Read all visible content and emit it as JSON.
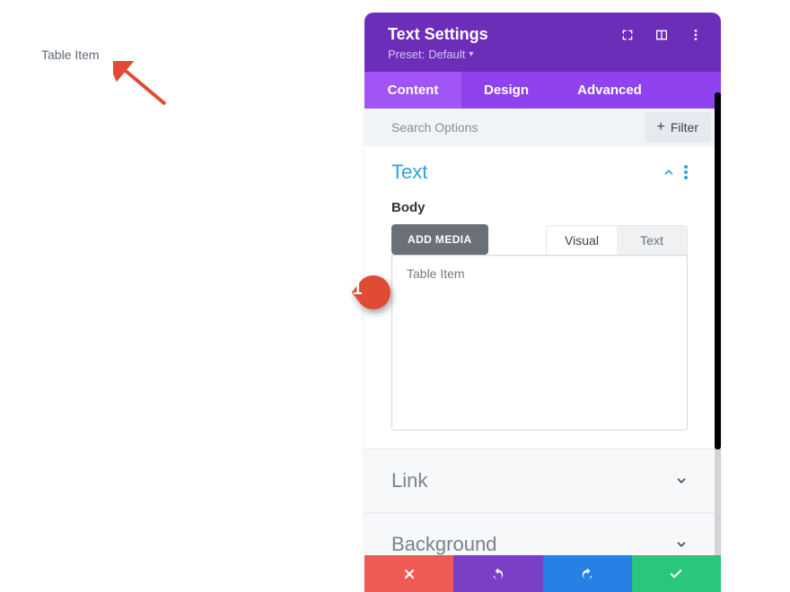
{
  "preview": {
    "text": "Table Item"
  },
  "panel": {
    "title": "Text Settings",
    "preset_label": "Preset:",
    "preset_value": "Default"
  },
  "tabs": {
    "content": "Content",
    "design": "Design",
    "advanced": "Advanced",
    "active": "content"
  },
  "search": {
    "placeholder": "Search Options",
    "filter_label": "Filter"
  },
  "sections": {
    "text": {
      "title": "Text",
      "body_label": "Body",
      "add_media": "ADD MEDIA"
    },
    "link": {
      "title": "Link"
    },
    "background": {
      "title": "Background"
    }
  },
  "editor": {
    "tabs": {
      "visual": "Visual",
      "text": "Text",
      "active": "visual"
    },
    "body_content": "Table Item"
  },
  "marker": {
    "value": "1"
  }
}
